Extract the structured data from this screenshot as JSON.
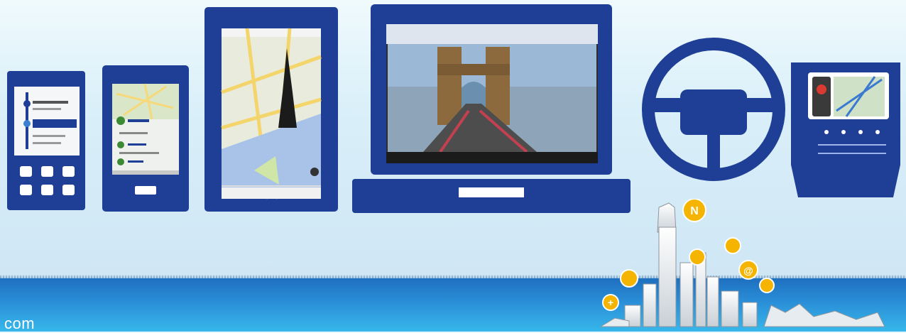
{
  "footer": {
    "text": "com"
  },
  "city": {
    "bubbles": [
      "N",
      "+",
      "@"
    ]
  },
  "colors": {
    "device_navy": "#1f3e95",
    "footer_blue": "#2a8fd8",
    "bubble_yellow": "#f5b400"
  },
  "icons": [
    "feature-phone-icon",
    "smartphone-icon",
    "tablet-icon",
    "laptop-icon",
    "steering-wheel-icon",
    "car-dashboard-icon",
    "skyline-icon"
  ]
}
